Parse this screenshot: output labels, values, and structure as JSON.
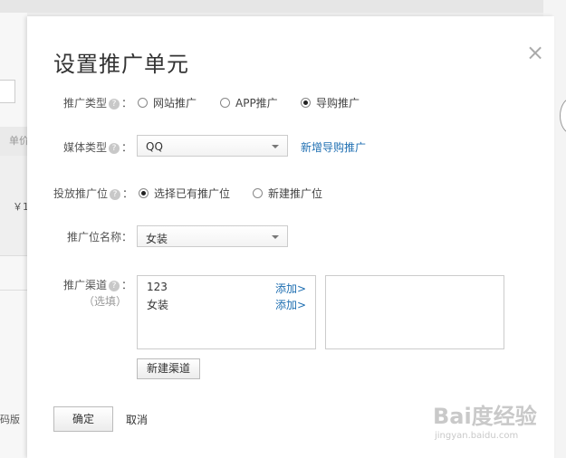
{
  "background": {
    "column_header": "单价",
    "price_fragment": "￥1",
    "footer_fragment": "码版"
  },
  "dialog": {
    "title": "设置推广单元",
    "close_glyph": "×",
    "promo_type": {
      "label": "推广类型",
      "help_glyph": "?",
      "colon": "：",
      "options": [
        "网站推广",
        "APP推广",
        "导购推广"
      ],
      "selected": "导购推广"
    },
    "media_type": {
      "label": "媒体类型",
      "help_glyph": "?",
      "colon": "：",
      "value": "QQ",
      "new_link": "新增导购推广"
    },
    "placement": {
      "label": "投放推广位",
      "help_glyph": "?",
      "colon": "：",
      "options": [
        "选择已有推广位",
        "新建推广位"
      ],
      "selected": "选择已有推广位"
    },
    "slot_name": {
      "label": "推广位名称：",
      "value": "女装"
    },
    "channel": {
      "label": "推广渠道",
      "help_glyph": "?",
      "colon": "：",
      "optional": "（选填）",
      "items": [
        {
          "name": "123",
          "action": "添加>"
        },
        {
          "name": "女装",
          "action": "添加>"
        }
      ],
      "new_button": "新建渠道"
    },
    "ok_button": "确定",
    "cancel_link": "取消"
  },
  "watermark": {
    "main": "Bai度经验",
    "sub": "jingyan.baidu.com"
  }
}
